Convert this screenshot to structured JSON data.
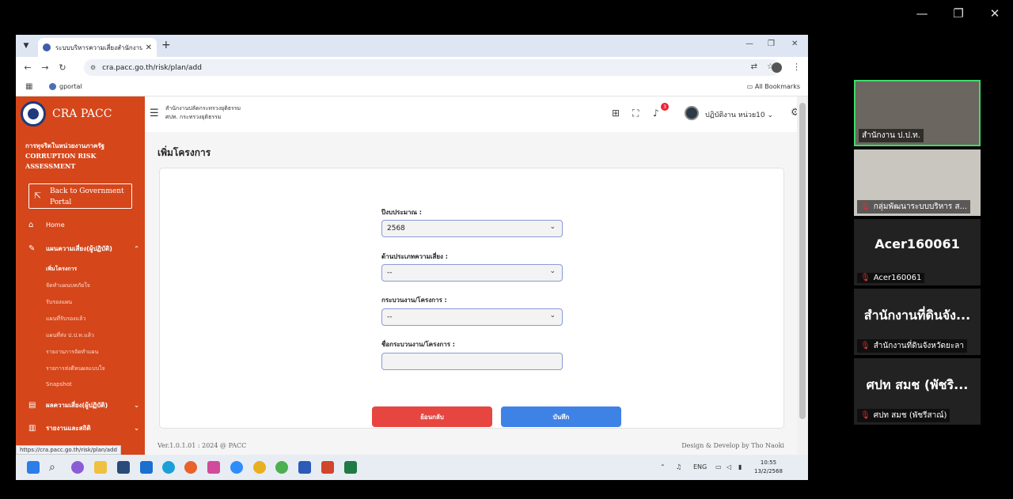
{
  "window_controls": {
    "minimize": "—",
    "restore": "❐",
    "close": "✕"
  },
  "browser": {
    "tab_title": "ระบบบริหารความเสี่ยงสำนักงาน ป.ป.ท.",
    "url": "cra.pacc.go.th/risk/plan/add",
    "bookmark": "gportal",
    "all_bookmarks": "All Bookmarks",
    "status_url": "https://cra.pacc.go.th/risk/plan/add"
  },
  "sidebar": {
    "brand": "CRA PACC",
    "subtitle": "การทุจริตในหน่วยงานภาครัฐ CORRUPTION RISK ASSESSMENT",
    "back_button": "Back to Government Portal",
    "home": "Home",
    "risk_plan": "แผนความเสี่ยง(ผู้ปฏิบัติ)",
    "sub_items": [
      "เพิ่มโครงการ",
      "จัดทำแผนบทภัยใจ",
      "รับรองแผน",
      "แผนที่รับรองแล้ว",
      "แผนที่ส่ง ป.ป.ท.แล้ว",
      "รายงานการจัดทำแผน",
      "รายการส่งดีหนผลแบบใจ",
      "Snapshot"
    ],
    "risk_result": "ผลความเสี่ยง(ผู้ปฏิบัติ)",
    "reports": "รายงานและสถิติ"
  },
  "topbar": {
    "org_line1": "สำนักงานปลัดกระทรวงยุติธรรม",
    "org_line2": "ศปท. กระทรวงยุติธรรม",
    "notification_count": "3",
    "user_name": "ปฏิบัติงาน หน่วย10 ⌄"
  },
  "page": {
    "title": "เพิ่มโครงการ",
    "fields": {
      "budget_year_label": "ปีงบประมาณ :",
      "budget_year_value": "2568",
      "risk_type_label": "ด้านประเภทความเสี่ยง :",
      "risk_type_value": "--",
      "process_label": "กระบวนงาน/โครงการ :",
      "process_value": "--",
      "process_name_label": "ชื่อกระบวนงาน/โครงการ :",
      "process_name_value": ""
    },
    "back_button": "ย้อนกลับ",
    "save_button": "บันทึก",
    "footer_left": "Ver.1.0.1.01 : 2024 @ PACC",
    "footer_right": "Design & Develop by Tho Naoki"
  },
  "taskbar": {
    "lang": "ENG",
    "time": "10:55",
    "date": "13/2/2568"
  },
  "participants": [
    {
      "name": "สำนักงาน ป.ป.ท.",
      "muted": false
    },
    {
      "name": "กลุ่มพัฒนาระบบบริหาร ส...",
      "muted": true
    },
    {
      "big": "Acer160061",
      "name": "Acer160061",
      "muted": true
    },
    {
      "big": "สำนักงานที่ดินจัง...",
      "name": "สำนักงานที่ดินจังหวัดยะลา",
      "muted": true
    },
    {
      "big": "ศปท สมช (พัชริ...",
      "name": "ศปท สมช (พัชรีสาณ์)",
      "muted": true
    }
  ],
  "colors": {
    "sidebar": "#d5461b",
    "back_btn": "#e6463f",
    "save_btn": "#3f82e6",
    "speaker_border": "#3ddc6a"
  }
}
